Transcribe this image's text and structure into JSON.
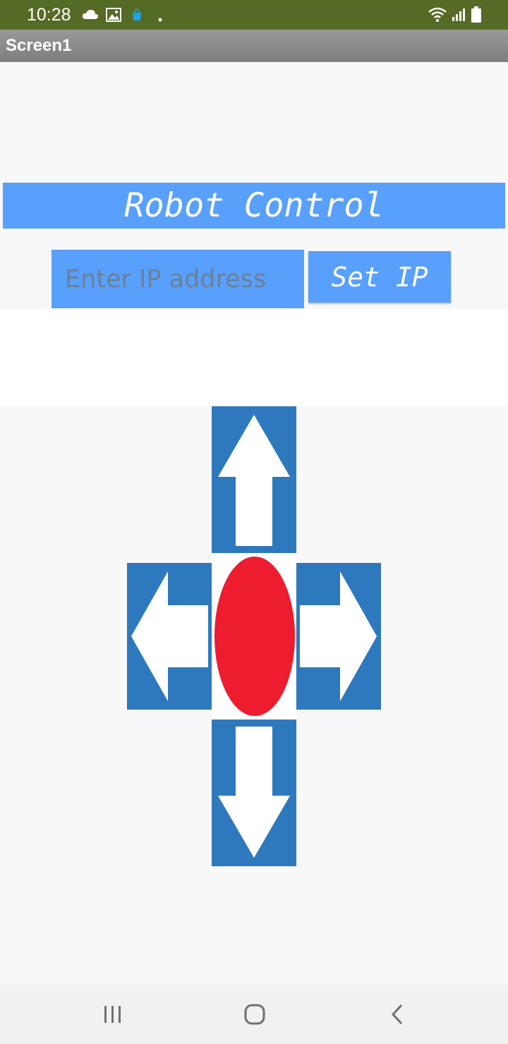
{
  "status_bar": {
    "time": "10:28",
    "background": "#556a25",
    "icons": [
      "cloud-icon",
      "image-icon",
      "shopping-bag-icon",
      "dot-icon",
      "wifi-icon",
      "signal-icon",
      "battery-icon"
    ]
  },
  "app_bar": {
    "title": "Screen1"
  },
  "main": {
    "title": "Robot Control",
    "ip_input": {
      "placeholder": "Enter IP address",
      "value": ""
    },
    "set_ip_label": "Set IP"
  },
  "controls": {
    "buttons": [
      "up-arrow-button",
      "left-arrow-button",
      "stop-button",
      "right-arrow-button",
      "down-arrow-button"
    ],
    "arrow_background": "#2e79be",
    "stop_color": "#ed1c2e"
  },
  "nav_bar": {
    "buttons": [
      "recent-apps-icon",
      "home-icon",
      "back-icon"
    ]
  },
  "colors": {
    "accent": "#58a0fb",
    "app_bar": "#8a8a8a"
  }
}
